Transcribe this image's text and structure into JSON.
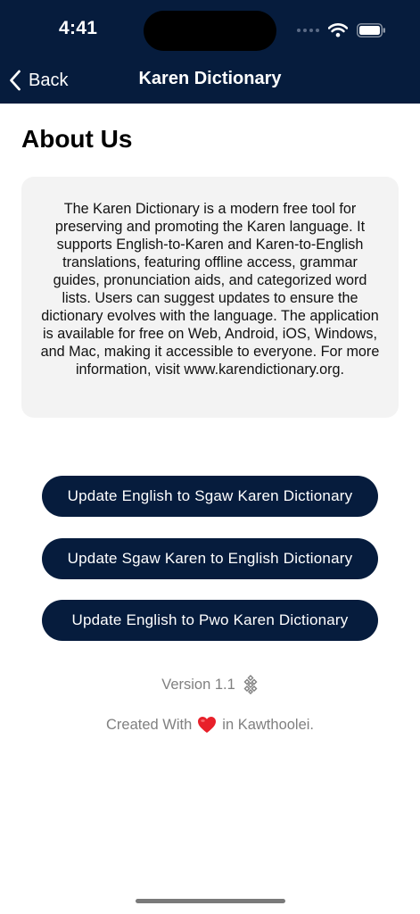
{
  "status_bar": {
    "time": "4:41"
  },
  "nav": {
    "back_label": "Back",
    "title": "Karen Dictionary"
  },
  "page": {
    "title": "About Us",
    "description": "The Karen Dictionary is a modern free tool for preserving and promoting the Karen language. It supports English-to-Karen and Karen-to-English translations, featuring offline access, grammar guides, pronunciation aids, and categorized word lists. Users can suggest updates to ensure the dictionary evolves with the language. The application is available for free on Web, Android, iOS, Windows, and Mac, making it accessible to everyone. For more information, visit www.karendictionary.org."
  },
  "actions": [
    {
      "label": "Update English to Sgaw Karen Dictionary"
    },
    {
      "label": "Update Sgaw Karen to English Dictionary"
    },
    {
      "label": "Update English to Pwo Karen Dictionary"
    }
  ],
  "footer": {
    "version": "Version 1.1",
    "credit_before": "Created With",
    "credit_after": "in Kawthoolei."
  },
  "icons": {
    "back": "chevron-left-icon",
    "wifi": "wifi-icon",
    "battery": "battery-icon",
    "version": "karen-bronze-drum-icon",
    "credit": "heart-icon"
  },
  "colors": {
    "header": "#061c3d",
    "button": "#061c3d",
    "card": "#f3f3f3",
    "muted_text": "#808080",
    "heart": "#e8202a"
  }
}
